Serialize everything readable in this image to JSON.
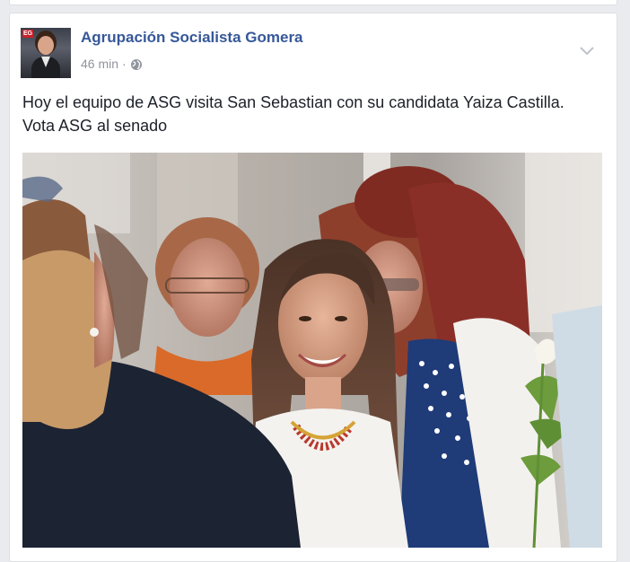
{
  "post": {
    "page_name": "Agrupación Socialista Gomera",
    "timestamp": "46 min",
    "separator": "·",
    "audience_icon": "globe-icon",
    "menu_icon": "chevron-down-icon",
    "text": "Hoy el equipo de ASG visita San Sebastian con su candidata Yaiza Castilla. Vota ASG al senado",
    "avatar": {
      "logo_text": "EG"
    }
  },
  "colors": {
    "page_background": "#e9ebee",
    "card_background": "#ffffff",
    "name_link": "#365899",
    "meta_text": "#90949c",
    "body_text": "#1d2129"
  }
}
